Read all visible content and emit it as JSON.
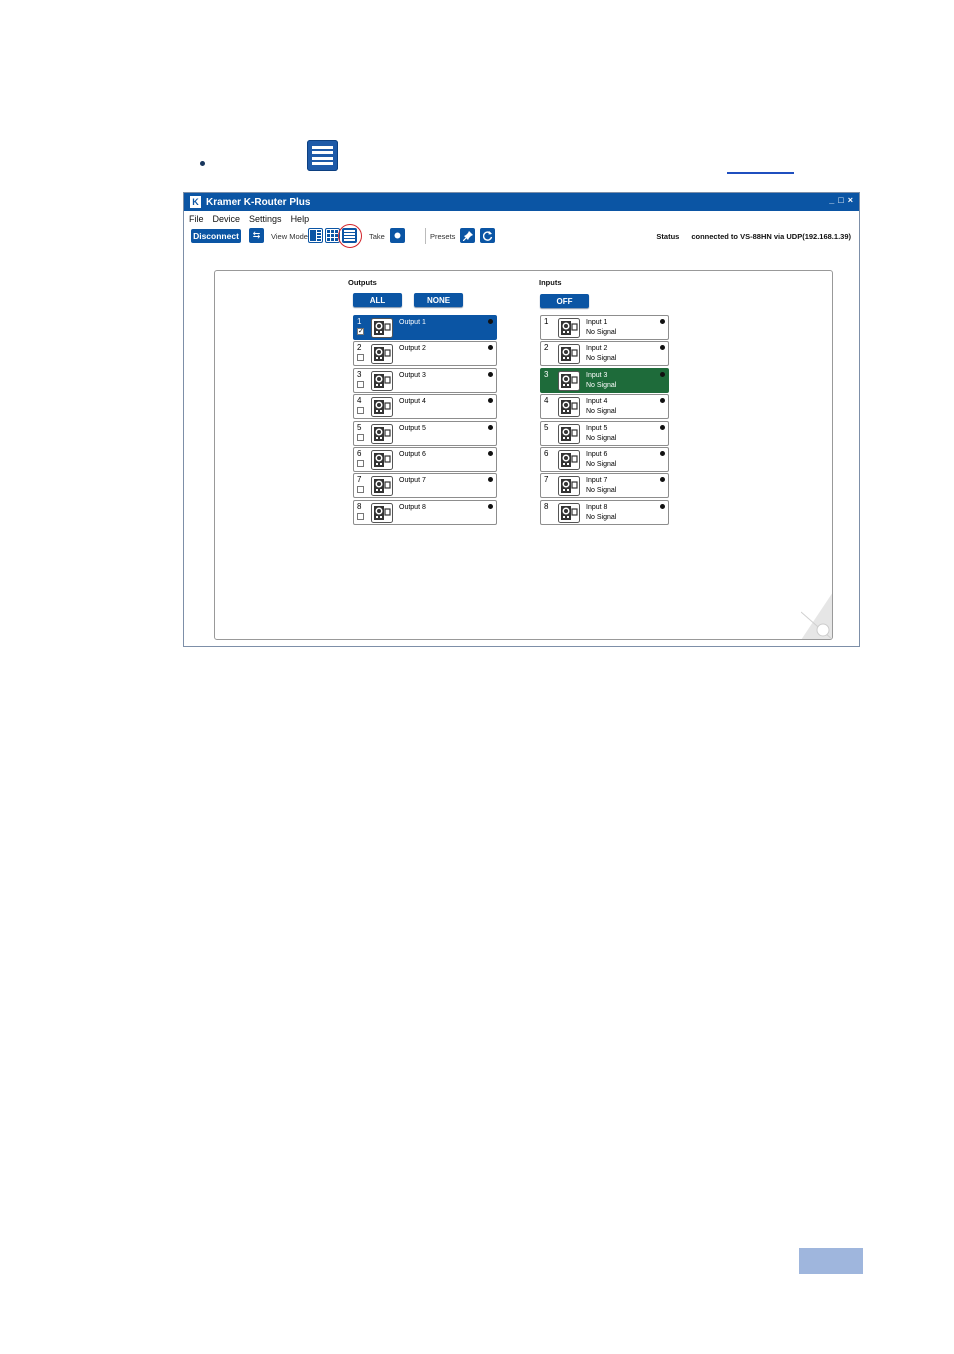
{
  "window": {
    "title": "Kramer K-Router Plus",
    "logo": "K",
    "controls": [
      "_",
      "□",
      "×"
    ]
  },
  "menu": [
    "File",
    "Device",
    "Settings",
    "Help"
  ],
  "toolbar": {
    "disconnect": "Disconnect",
    "view_mode_label": "View Mode",
    "take_label": "Take",
    "presets_label": "Presets",
    "status_label": "Status",
    "status_text": "connected to VS-88HN  via UDP(192.168.1.39)"
  },
  "outputs": {
    "title": "Outputs",
    "all": "ALL",
    "none": "NONE",
    "items": [
      {
        "num": "1",
        "label": "Output 1",
        "checked": true,
        "selected": true
      },
      {
        "num": "2",
        "label": "Output 2",
        "checked": false,
        "selected": false
      },
      {
        "num": "3",
        "label": "Output 3",
        "checked": false,
        "selected": false
      },
      {
        "num": "4",
        "label": "Output 4",
        "checked": false,
        "selected": false
      },
      {
        "num": "5",
        "label": "Output 5",
        "checked": false,
        "selected": false
      },
      {
        "num": "6",
        "label": "Output 6",
        "checked": false,
        "selected": false
      },
      {
        "num": "7",
        "label": "Output 7",
        "checked": false,
        "selected": false
      },
      {
        "num": "8",
        "label": "Output 8",
        "checked": false,
        "selected": false
      }
    ]
  },
  "inputs": {
    "title": "Inputs",
    "off": "OFF",
    "items": [
      {
        "num": "1",
        "label": "Input 1",
        "signal": "No Signal",
        "selected": false
      },
      {
        "num": "2",
        "label": "Input 2",
        "signal": "No Signal",
        "selected": false
      },
      {
        "num": "3",
        "label": "Input 3",
        "signal": "No Signal",
        "selected": true
      },
      {
        "num": "4",
        "label": "Input 4",
        "signal": "No Signal",
        "selected": false
      },
      {
        "num": "5",
        "label": "Input 5",
        "signal": "No Signal",
        "selected": false
      },
      {
        "num": "6",
        "label": "Input 6",
        "signal": "No Signal",
        "selected": false
      },
      {
        "num": "7",
        "label": "Input 7",
        "signal": "No Signal",
        "selected": false
      },
      {
        "num": "8",
        "label": "Input 8",
        "signal": "No Signal",
        "selected": false
      }
    ]
  },
  "colors": {
    "kramer_blue": "#0b55a4",
    "input_selected": "#1e6b3a",
    "highlight_ring": "#d2232a"
  }
}
